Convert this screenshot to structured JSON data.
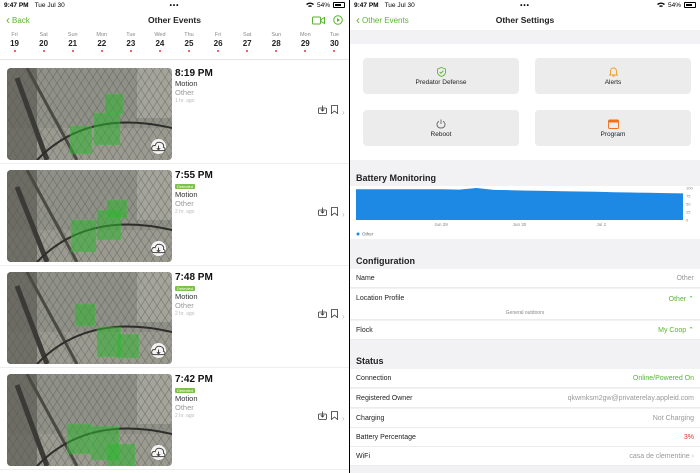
{
  "left_status": {
    "time": "9:47 PM",
    "date": "Tue Jul 30",
    "dots": "•••",
    "battery": "54%"
  },
  "left_nav": {
    "back": "Back",
    "title": "Other Events"
  },
  "days": [
    {
      "name": "Fri",
      "num": "19"
    },
    {
      "name": "Sat",
      "num": "20"
    },
    {
      "name": "Sun",
      "num": "21"
    },
    {
      "name": "Mon",
      "num": "22"
    },
    {
      "name": "Tue",
      "num": "23"
    },
    {
      "name": "Wed",
      "num": "24"
    },
    {
      "name": "Thu",
      "num": "25"
    },
    {
      "name": "Fri",
      "num": "26"
    },
    {
      "name": "Sat",
      "num": "27"
    },
    {
      "name": "Sun",
      "num": "28"
    },
    {
      "name": "Mon",
      "num": "29"
    },
    {
      "name": "Tue",
      "num": "30"
    }
  ],
  "events": [
    {
      "time": "8:19 PM",
      "badge": "",
      "type": "Motion",
      "sub": "Other",
      "ago": "1 hr. ago"
    },
    {
      "time": "7:55 PM",
      "badge": "Detected",
      "type": "Motion",
      "sub": "Other",
      "ago": "2 hr. ago"
    },
    {
      "time": "7:48 PM",
      "badge": "Detected",
      "type": "Motion",
      "sub": "Other",
      "ago": "2 hr. ago"
    },
    {
      "time": "7:42 PM",
      "badge": "Detected",
      "type": "Motion",
      "sub": "Other",
      "ago": "2 hr. ago"
    }
  ],
  "right_status": {
    "time": "9:47 PM",
    "date": "Tue Jul 30",
    "dots": "•••",
    "battery": "54%"
  },
  "right_nav": {
    "back": "Other Events",
    "title": "Other Settings"
  },
  "tiles": {
    "predator": "Predator Defense",
    "alerts": "Alerts",
    "reboot": "Reboot",
    "program": "Program"
  },
  "battery_section": {
    "title": "Battery Monitoring",
    "legend": "Other",
    "chart_data": {
      "type": "area",
      "x_ticks": [
        "Jun 29",
        "Jun 30",
        "Jul 2"
      ],
      "y_ticks": [
        "100",
        "75",
        "50",
        "25",
        "0"
      ],
      "ylim": [
        0,
        100
      ],
      "series": [
        {
          "name": "Other",
          "color": "#1e88e5",
          "values": [
            96,
            96,
            96,
            96,
            96,
            96,
            95,
            100,
            94,
            93,
            92,
            91,
            90,
            89,
            88,
            87,
            86,
            85,
            84,
            83
          ]
        }
      ]
    }
  },
  "configuration": {
    "title": "Configuration",
    "name_label": "Name",
    "name_value": "Other",
    "location_label": "Location Profile",
    "location_value": "Other",
    "location_sub": "General outdoors",
    "flock_label": "Flock",
    "flock_value": "My Coop"
  },
  "status": {
    "title": "Status",
    "connection_label": "Connection",
    "connection_value": "Online/Powered On",
    "owner_label": "Registered Owner",
    "owner_value": "qkwmksm2gw@privaterelay.appleid.com",
    "charging_label": "Charging",
    "charging_value": "Not Charging",
    "battery_label": "Battery Percentage",
    "battery_value": "3%",
    "wifi_label": "WiFi",
    "wifi_value": "casa de clementine"
  },
  "colors": {
    "accent": "#5ab52e",
    "chart": "#1e88e5",
    "alert": "#e0332f"
  }
}
